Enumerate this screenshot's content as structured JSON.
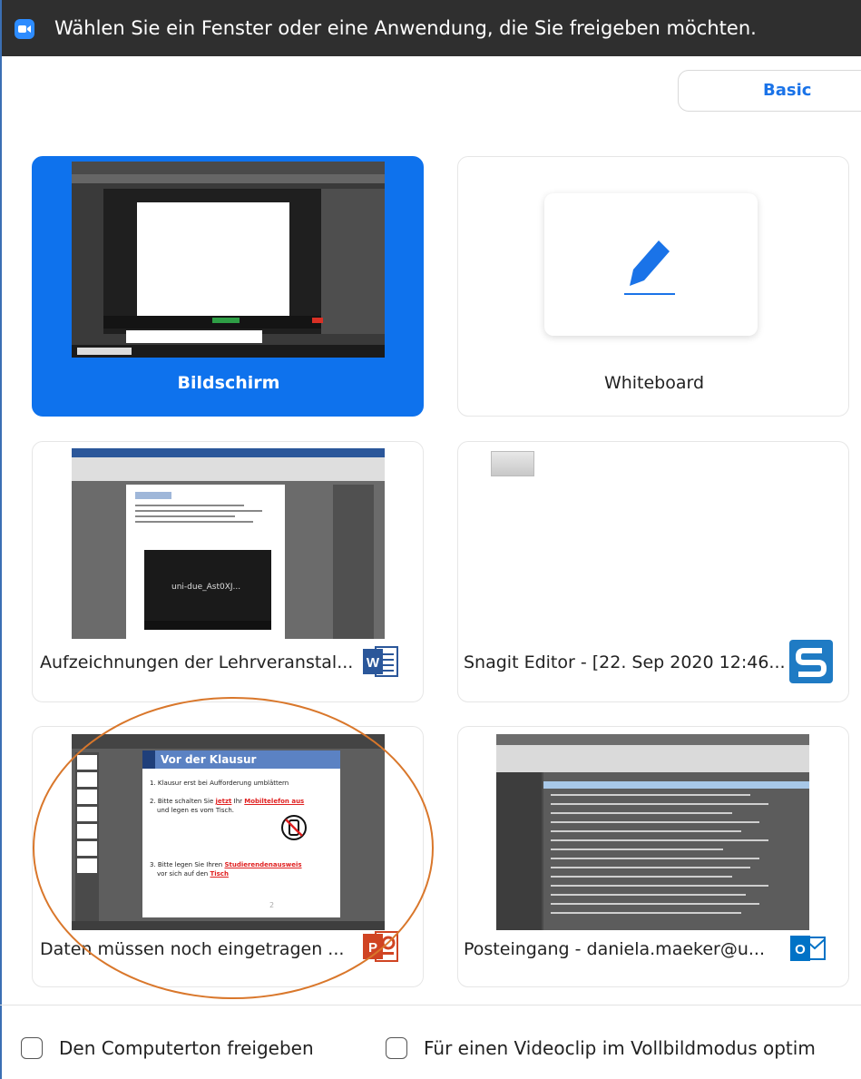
{
  "titlebar": {
    "icon": "zoom-camera-icon",
    "title": "Wählen Sie ein Fenster oder eine Anwendung, die Sie freigeben möchten."
  },
  "mode_tabs": {
    "basic": "Basic"
  },
  "cards": [
    {
      "label": "Bildschirm",
      "kind": "screen",
      "selected": true
    },
    {
      "label": "Whiteboard",
      "kind": "whiteboard",
      "icon": "pen-icon"
    },
    {
      "label": "Aufzeichnungen der Lehrveranstal...",
      "kind": "window",
      "app_icon": "word-icon",
      "thumb_text": "uni-due_Ast0XJ..."
    },
    {
      "label": "Snagit Editor - [22. Sep 2020 12:46...",
      "kind": "window",
      "app_icon": "snagit-icon"
    },
    {
      "label": "Daten müssen noch eingetragen ...",
      "kind": "window",
      "app_icon": "powerpoint-icon",
      "slide": {
        "title": "Vor der Klausur",
        "item1": "1. Klausur erst bei Aufforderung umblättern",
        "item2a": "2. Bitte schalten Sie ",
        "item2b": "jetzt",
        "item2c": " Ihr ",
        "item2d": "Mobiltelefon aus",
        "item2e": "und legen es vom Tisch.",
        "item3a": "3. Bitte legen Sie Ihren ",
        "item3b": "Studierendenausweis",
        "item3c": "vor sich auf den ",
        "item3d": "Tisch",
        "footer": "2"
      }
    },
    {
      "label": "Posteingang - daniela.maeker@u...",
      "kind": "window",
      "app_icon": "outlook-icon"
    }
  ],
  "options": {
    "computer_audio": "Den Computerton freigeben",
    "video_clip": "Für einen Videoclip im Vollbildmodus optim"
  },
  "colors": {
    "accent": "#0e72ed",
    "annotation": "#d9772b",
    "titlebar": "#2f2f2f"
  }
}
